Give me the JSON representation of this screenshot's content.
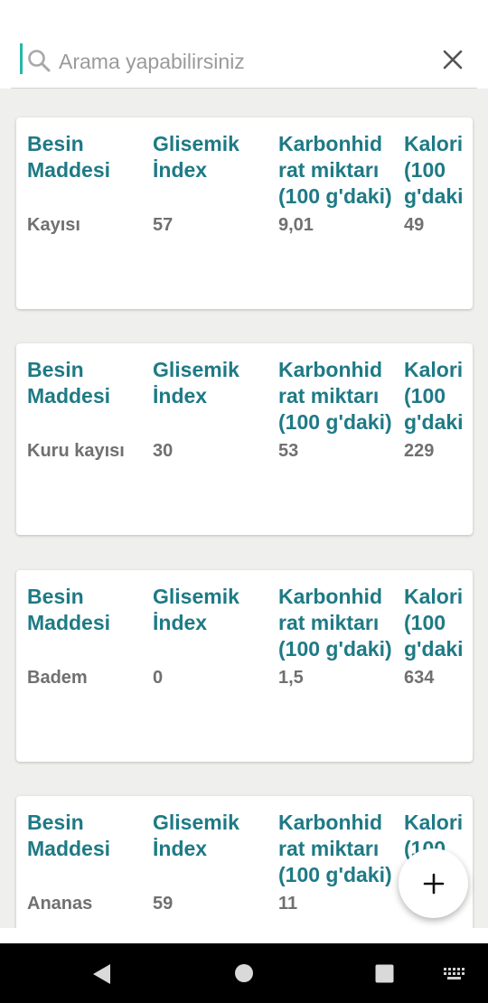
{
  "search": {
    "placeholder": "Arama yapabilirsiniz"
  },
  "headers": {
    "name": "Besin\nMaddesi",
    "glycemic": "Glisemik\nİndex",
    "carbs": "Karbonhid\nrat miktarı\n(100 g'daki)",
    "calories": "Kalori\n(100\ng'daki"
  },
  "items": [
    {
      "name": "Kayısı",
      "glycemic_index": "57",
      "carbs": "9,01",
      "calories": "49"
    },
    {
      "name": "Kuru kayısı",
      "glycemic_index": "30",
      "carbs": "53",
      "calories": "229"
    },
    {
      "name": "Badem",
      "glycemic_index": "0",
      "carbs": "1,5",
      "calories": "634"
    },
    {
      "name": "Ananas",
      "glycemic_index": "59",
      "carbs": "11",
      "calories": ""
    }
  ],
  "icons": {
    "search": "search-icon",
    "clear": "close-icon",
    "fab": "plus-icon",
    "nav": [
      "back-icon",
      "home-icon",
      "recents-icon",
      "keyboard-icon"
    ]
  },
  "colors": {
    "accent": "#26b7a7",
    "header_text": "#1e7a85",
    "value_text": "#707070",
    "background": "#efefed"
  }
}
